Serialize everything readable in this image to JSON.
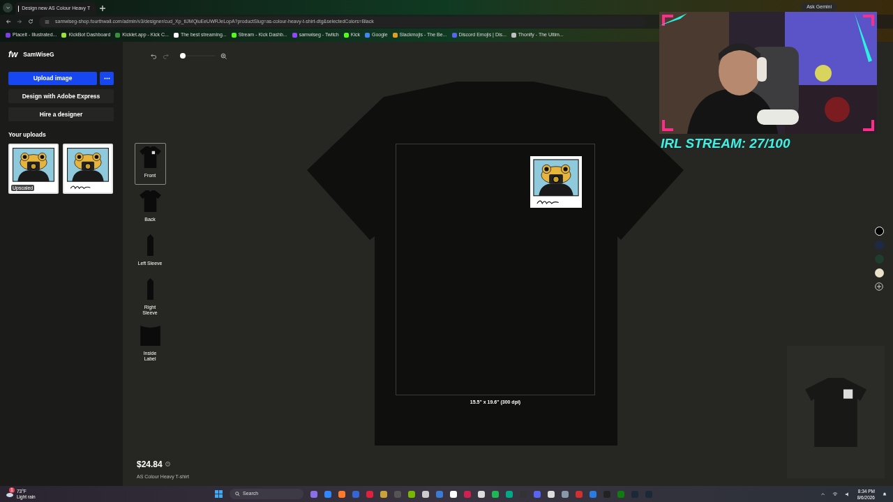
{
  "browser": {
    "tab": {
      "title": "Design new AS Colour Heavy T",
      "selected": true
    },
    "url": "samwiseg-shop.fourthwall.com/admin/v3/designer/cud_Xp_tIJMQluEeUWRJeLopA?productSlug=as-colour-heavy-t-shirt-dtg&selectedColors=Black",
    "ask_gemini": "Ask Gemini",
    "bookmarks": [
      "Placeit - Illustrated...",
      "KickBot Dashboard",
      "Kicklet.app - Kick C...",
      "The best streaming...",
      "Stream - Kick Dashb...",
      "samwiseg - Twitch",
      "Kick",
      "Google",
      "Slackmojis - The Be...",
      "Discord Emojis | Dis...",
      "Thonify - The Ultim..."
    ]
  },
  "sidebar": {
    "logo": "fw",
    "store_name": "SamWiseG",
    "upload_button": "Upload image",
    "buttons": [
      "Design with Adobe Express",
      "Hire a designer"
    ],
    "uploads_title": "Your uploads",
    "uploads": [
      {
        "kind": "upscaled",
        "badge": "Upscaled"
      },
      {
        "kind": "signed"
      }
    ]
  },
  "zoom": {
    "level": 0
  },
  "views": [
    {
      "label": "Front",
      "kind": "shirt",
      "selected": true,
      "has_design": true
    },
    {
      "label": "Back",
      "kind": "shirt",
      "selected": false,
      "has_design": false
    },
    {
      "label": "Left Sleeve",
      "kind": "sleeve",
      "selected": false,
      "has_design": false
    },
    {
      "label": "Right Sleeve",
      "kind": "sleeve",
      "selected": false,
      "has_design": false
    },
    {
      "label": "Inside Label",
      "kind": "label",
      "selected": false,
      "has_design": false
    }
  ],
  "print_area": {
    "size": "15.5\" x 19.6\" (300 dpi)"
  },
  "colors": [
    {
      "color": "#000000",
      "selected": true
    },
    {
      "color": "#1e2a44",
      "selected": false
    },
    {
      "color": "#1f3d2e",
      "selected": false
    },
    {
      "color": "#e8e2c8",
      "selected": false
    }
  ],
  "price": {
    "amount": "$24.84",
    "product": "AS Colour Heavy T-shirt"
  },
  "overlay": {
    "caption": "IRL STREAM: 27/100"
  },
  "taskbar": {
    "weather": {
      "alerts": "1",
      "temp": "73°F",
      "condition": "Light rain"
    },
    "search": "Search",
    "time": "8:34 PM",
    "date": "8/6/2026"
  }
}
